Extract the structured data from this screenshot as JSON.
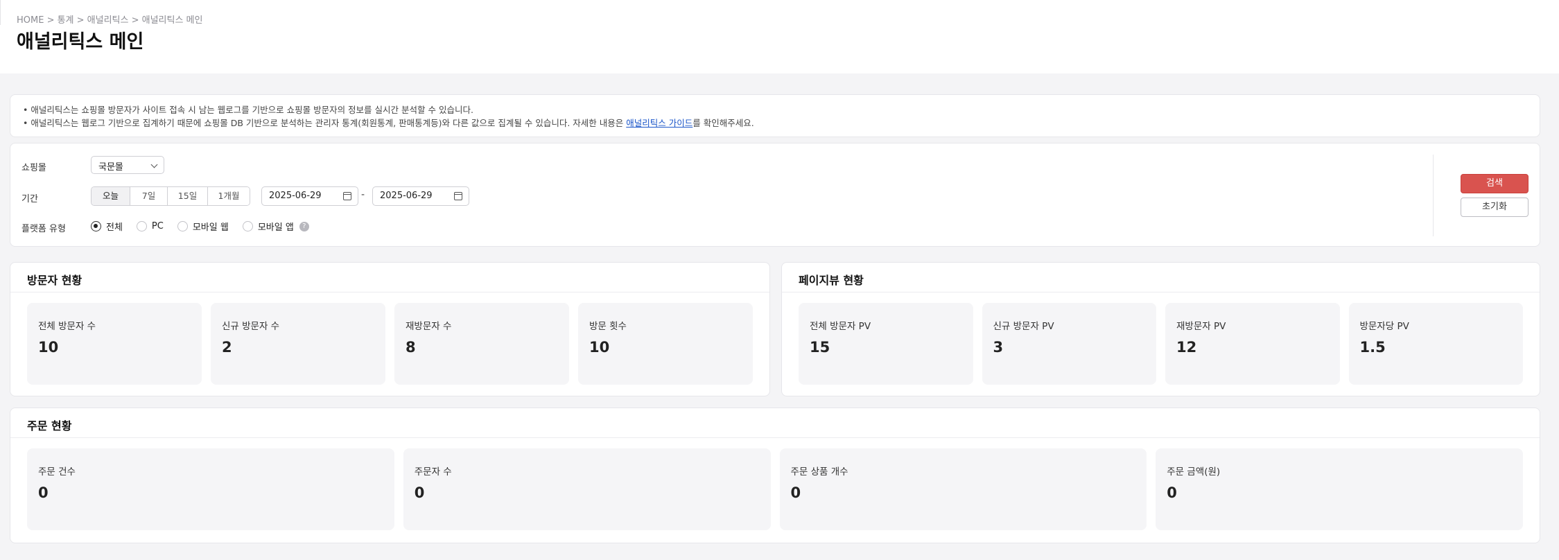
{
  "header": {
    "breadcrumb": "HOME > 통계 > 애널리틱스 > 애널리틱스 메인",
    "title": "애널리틱스 메인"
  },
  "notice": {
    "line1": "• 애널리틱스는 쇼핑몰 방문자가 사이트 접속 시 남는 웹로그를 기반으로 쇼핑몰 방문자의 정보를 실시간 분석할 수 있습니다.",
    "line2_before": "• 애널리틱스는 웹로그 기반으로 집계하기 때문에 쇼핑몰 DB 기반으로 분석하는 관리자 통계(회원통계, 판매통계등)와 다른 값으로 집계될 수 있습니다. 자세한 내용은 ",
    "line2_link": "애널리틱스 가이드",
    "line2_after": "를 확인해주세요."
  },
  "filter": {
    "mall_label": "쇼핑몰",
    "mall_value": "국문몰",
    "period_label": "기간",
    "period_options": [
      "오늘",
      "7일",
      "15일",
      "1개월"
    ],
    "date_from": "2025-06-29",
    "date_separator": "-",
    "date_to": "2025-06-29",
    "platform_label": "플랫폼 유형",
    "platform_options": [
      "전체",
      "PC",
      "모바일 웹",
      "모바일 앱"
    ],
    "help": "?",
    "search_button": "검색",
    "reset_button": "초기화"
  },
  "visitor": {
    "title": "방문자 현황",
    "cards": [
      {
        "label": "전체 방문자 수",
        "value": "10"
      },
      {
        "label": "신규 방문자 수",
        "value": "2"
      },
      {
        "label": "재방문자 수",
        "value": "8"
      },
      {
        "label": "방문 횟수",
        "value": "10"
      }
    ]
  },
  "pageview": {
    "title": "페이지뷰 현황",
    "cards": [
      {
        "label": "전체 방문자 PV",
        "value": "15"
      },
      {
        "label": "신규 방문자 PV",
        "value": "3"
      },
      {
        "label": "재방문자 PV",
        "value": "12"
      },
      {
        "label": "방문자당 PV",
        "value": "1.5"
      }
    ]
  },
  "orders": {
    "title": "주문 현황",
    "cards": [
      {
        "label": "주문 건수",
        "value": "0"
      },
      {
        "label": "주문자 수",
        "value": "0"
      },
      {
        "label": "주문 상품 개수",
        "value": "0"
      },
      {
        "label": "주문 금액(원)",
        "value": "0"
      }
    ]
  }
}
